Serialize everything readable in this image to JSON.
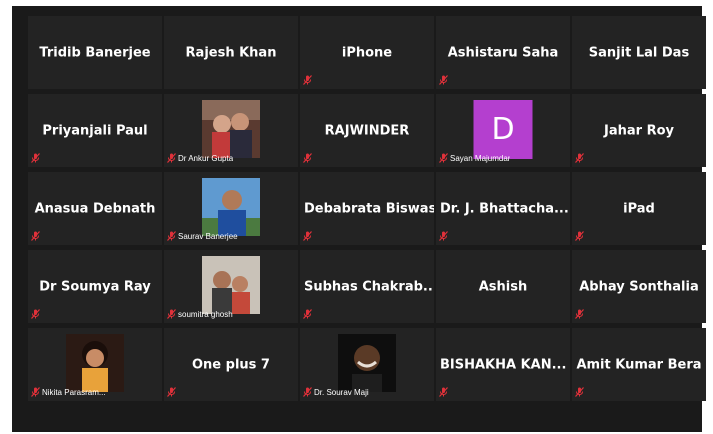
{
  "participants": [
    {
      "name": "Tridib Banerjee",
      "type": "name",
      "muted": false
    },
    {
      "name": "Rajesh  Khan",
      "type": "name",
      "muted": false
    },
    {
      "name": "iPhone",
      "type": "name",
      "muted": true
    },
    {
      "name": "Ashistaru Saha",
      "type": "name",
      "muted": true
    },
    {
      "name": "Sanjit Lal Das",
      "type": "name",
      "muted": false
    },
    {
      "name": "Priyanjali Paul",
      "type": "name",
      "muted": true
    },
    {
      "name": "Dr Ankur Gupta",
      "type": "video",
      "video": "couple",
      "muted": true
    },
    {
      "name": "RAJWINDER",
      "type": "name",
      "muted": true
    },
    {
      "name": "Sayan Majumdar",
      "type": "avatar",
      "letter": "D",
      "muted": true
    },
    {
      "name": "Jahar Roy",
      "type": "name",
      "muted": true
    },
    {
      "name": "Anasua Debnath",
      "type": "name",
      "muted": true
    },
    {
      "name": "Saurav Banerjee",
      "type": "video",
      "video": "man-outdoor",
      "muted": true
    },
    {
      "name": "Debabrata Biswas",
      "type": "name",
      "muted": true
    },
    {
      "name": "Dr. J. Bhattacha...",
      "type": "name",
      "muted": true
    },
    {
      "name": "iPad",
      "type": "name",
      "muted": true
    },
    {
      "name": "Dr Soumya Ray",
      "type": "name",
      "muted": true
    },
    {
      "name": "soumitra ghosh",
      "type": "video",
      "video": "group",
      "muted": true
    },
    {
      "name": "Subhas  Chakrab...",
      "type": "name",
      "muted": true
    },
    {
      "name": "Ashish",
      "type": "name",
      "muted": false
    },
    {
      "name": "Abhay Sonthalia",
      "type": "name",
      "muted": true
    },
    {
      "name": "Nikita Parasram...",
      "type": "video",
      "video": "woman",
      "muted": true
    },
    {
      "name": "One plus 7",
      "type": "name",
      "muted": true
    },
    {
      "name": "Dr. Sourav Maji",
      "type": "video",
      "video": "man-dark",
      "muted": true
    },
    {
      "name": "BISHAKHA  KAN...",
      "type": "name",
      "muted": true
    },
    {
      "name": "Amit Kumar Bera",
      "type": "name",
      "muted": true
    }
  ],
  "colors": {
    "background": "#1a1a1a",
    "tile": "#232323",
    "muted_icon": "#e0313a",
    "avatar": "#b43fcf"
  },
  "icons": {
    "muted": "mic-muted-icon"
  }
}
